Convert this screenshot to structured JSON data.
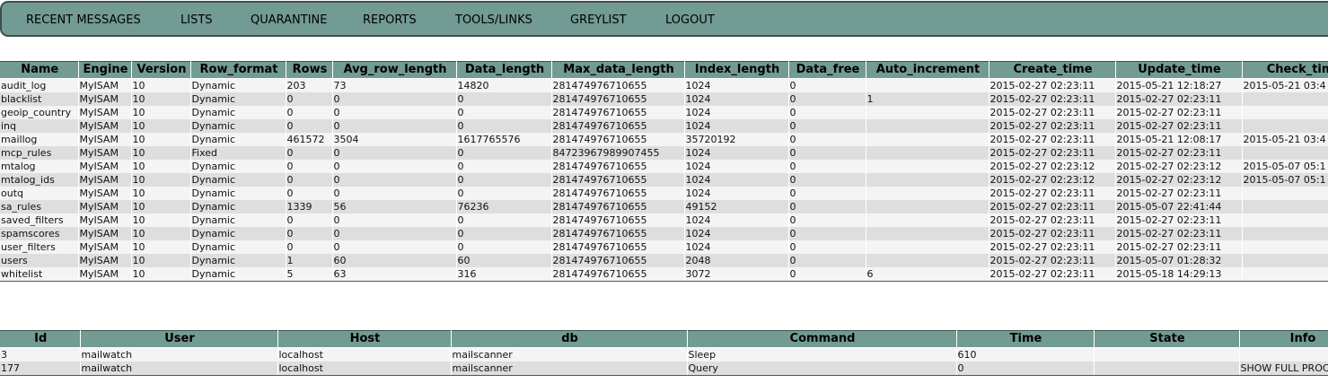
{
  "nav": [
    {
      "label": "RECENT MESSAGES"
    },
    {
      "label": "LISTS"
    },
    {
      "label": "QUARANTINE"
    },
    {
      "label": "REPORTS"
    },
    {
      "label": "TOOLS/LINKS"
    },
    {
      "label": "GREYLIST"
    },
    {
      "label": "LOGOUT"
    }
  ],
  "status_table": {
    "headers": [
      "Name",
      "Engine",
      "Version",
      "Row_format",
      "Rows",
      "Avg_row_length",
      "Data_length",
      "Max_data_length",
      "Index_length",
      "Data_free",
      "Auto_increment",
      "Create_time",
      "Update_time",
      "Check_time"
    ],
    "rows": [
      [
        "audit_log",
        "MyISAM",
        "10",
        "Dynamic",
        "203",
        "73",
        "14820",
        "281474976710655",
        "1024",
        "0",
        "",
        "2015-02-27 02:23:11",
        "2015-05-21 12:18:27",
        "2015-05-21 03:4"
      ],
      [
        "blacklist",
        "MyISAM",
        "10",
        "Dynamic",
        "0",
        "0",
        "0",
        "281474976710655",
        "1024",
        "0",
        "1",
        "2015-02-27 02:23:11",
        "2015-02-27 02:23:11",
        ""
      ],
      [
        "geoip_country",
        "MyISAM",
        "10",
        "Dynamic",
        "0",
        "0",
        "0",
        "281474976710655",
        "1024",
        "0",
        "",
        "2015-02-27 02:23:11",
        "2015-02-27 02:23:11",
        ""
      ],
      [
        "inq",
        "MyISAM",
        "10",
        "Dynamic",
        "0",
        "0",
        "0",
        "281474976710655",
        "1024",
        "0",
        "",
        "2015-02-27 02:23:11",
        "2015-02-27 02:23:11",
        ""
      ],
      [
        "maillog",
        "MyISAM",
        "10",
        "Dynamic",
        "461572",
        "3504",
        "1617765576",
        "281474976710655",
        "35720192",
        "0",
        "",
        "2015-02-27 02:23:11",
        "2015-05-21 12:08:17",
        "2015-05-21 03:4"
      ],
      [
        "mcp_rules",
        "MyISAM",
        "10",
        "Fixed",
        "0",
        "0",
        "0",
        "84723967989907455",
        "1024",
        "0",
        "",
        "2015-02-27 02:23:11",
        "2015-02-27 02:23:11",
        ""
      ],
      [
        "mtalog",
        "MyISAM",
        "10",
        "Dynamic",
        "0",
        "0",
        "0",
        "281474976710655",
        "1024",
        "0",
        "",
        "2015-02-27 02:23:12",
        "2015-02-27 02:23:12",
        "2015-05-07 05:1"
      ],
      [
        "mtalog_ids",
        "MyISAM",
        "10",
        "Dynamic",
        "0",
        "0",
        "0",
        "281474976710655",
        "1024",
        "0",
        "",
        "2015-02-27 02:23:12",
        "2015-02-27 02:23:12",
        "2015-05-07 05:1"
      ],
      [
        "outq",
        "MyISAM",
        "10",
        "Dynamic",
        "0",
        "0",
        "0",
        "281474976710655",
        "1024",
        "0",
        "",
        "2015-02-27 02:23:11",
        "2015-02-27 02:23:11",
        ""
      ],
      [
        "sa_rules",
        "MyISAM",
        "10",
        "Dynamic",
        "1339",
        "56",
        "76236",
        "281474976710655",
        "49152",
        "0",
        "",
        "2015-02-27 02:23:11",
        "2015-05-07 22:41:44",
        ""
      ],
      [
        "saved_filters",
        "MyISAM",
        "10",
        "Dynamic",
        "0",
        "0",
        "0",
        "281474976710655",
        "1024",
        "0",
        "",
        "2015-02-27 02:23:11",
        "2015-02-27 02:23:11",
        ""
      ],
      [
        "spamscores",
        "MyISAM",
        "10",
        "Dynamic",
        "0",
        "0",
        "0",
        "281474976710655",
        "1024",
        "0",
        "",
        "2015-02-27 02:23:11",
        "2015-02-27 02:23:11",
        ""
      ],
      [
        "user_filters",
        "MyISAM",
        "10",
        "Dynamic",
        "0",
        "0",
        "0",
        "281474976710655",
        "1024",
        "0",
        "",
        "2015-02-27 02:23:11",
        "2015-02-27 02:23:11",
        ""
      ],
      [
        "users",
        "MyISAM",
        "10",
        "Dynamic",
        "1",
        "60",
        "60",
        "281474976710655",
        "2048",
        "0",
        "",
        "2015-02-27 02:23:11",
        "2015-05-07 01:28:32",
        ""
      ],
      [
        "whitelist",
        "MyISAM",
        "10",
        "Dynamic",
        "5",
        "63",
        "316",
        "281474976710655",
        "3072",
        "0",
        "6",
        "2015-02-27 02:23:11",
        "2015-05-18 14:29:13",
        ""
      ]
    ]
  },
  "process_table": {
    "headers": [
      "Id",
      "User",
      "Host",
      "db",
      "Command",
      "Time",
      "State",
      "Info"
    ],
    "rows": [
      [
        "3",
        "mailwatch",
        "localhost",
        "mailscanner",
        "Sleep",
        "610",
        "",
        ""
      ],
      [
        "177",
        "mailwatch",
        "localhost",
        "mailscanner",
        "Query",
        "0",
        "",
        "SHOW FULL PROC"
      ]
    ]
  }
}
